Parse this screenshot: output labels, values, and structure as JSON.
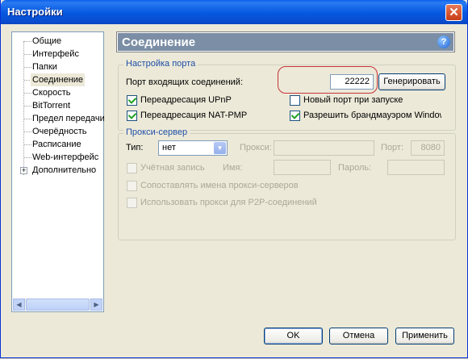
{
  "window": {
    "title": "Настройки",
    "close_symbol": "✕"
  },
  "sidebar": {
    "items": [
      {
        "label": "Общие"
      },
      {
        "label": "Интерфейс"
      },
      {
        "label": "Папки"
      },
      {
        "label": "Соединение",
        "selected": true
      },
      {
        "label": "Скорость"
      },
      {
        "label": "BitTorrent"
      },
      {
        "label": "Предел передачи"
      },
      {
        "label": "Очерёдность"
      },
      {
        "label": "Расписание"
      },
      {
        "label": "Web-интерфейс"
      },
      {
        "label": "Дополнительно",
        "expandable": true
      }
    ],
    "expand_symbol": "+"
  },
  "section": {
    "title": "Соединение",
    "help_symbol": "?"
  },
  "port": {
    "group_label": "Настройка порта",
    "incoming_label": "Порт входящих соединений:",
    "incoming_value": "22222",
    "generate_button": "Генерировать",
    "upnp": {
      "label": "Переадресация UPnP",
      "checked": true
    },
    "random_port": {
      "label": "Новый порт при запуске",
      "checked": false
    },
    "natpmp": {
      "label": "Переадресация NAT-PMP",
      "checked": true
    },
    "firewall": {
      "label": "Разрешить брандмауэром Windows",
      "checked": true
    }
  },
  "proxy": {
    "group_label": "Прокси-сервер",
    "type_label": "Тип:",
    "type_value": "нет",
    "proxy_label": "Прокси:",
    "proxy_value": "",
    "port_label": "Порт:",
    "port_value": "8080",
    "auth": {
      "label": "Учётная запись",
      "checked": false
    },
    "username_label": "Имя:",
    "password_label": "Пароль:",
    "resolve_names": {
      "label": "Сопоставлять имена прокси-серверов",
      "checked": false
    },
    "p2p": {
      "label": "Использовать прокси для P2P-соединений",
      "checked": false
    }
  },
  "buttons": {
    "ok": "OK",
    "cancel": "Отмена",
    "apply": "Применить"
  },
  "scrollbar": {
    "left_arrow": "◀",
    "right_arrow": "▶"
  },
  "colors": {
    "titlebar": "#0a5fe8",
    "header": "#7b8ea5",
    "accent_text": "#1f4fa8",
    "highlight_ring": "#c8323a"
  }
}
